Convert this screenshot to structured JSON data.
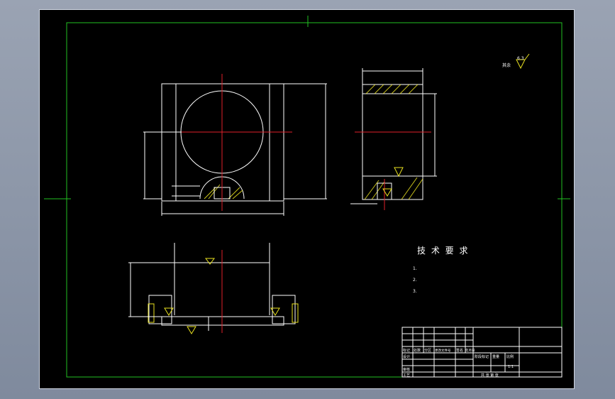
{
  "drawing": {
    "tech_requirements_title": "技 术 要 求",
    "tech_requirements": [
      "1.",
      "2.",
      "3."
    ],
    "surface_roughness_note": "其余",
    "roughness_value": "6.3"
  },
  "title_block": {
    "name_cell": "",
    "row_labels": [
      "标记",
      "处数",
      "分区",
      "更改文件号",
      "签名",
      "年月日"
    ],
    "roles": [
      "设计",
      "审核",
      "工艺"
    ],
    "right_labels": [
      "阶段标记",
      "重量",
      "比例"
    ],
    "scale": "1:1",
    "sheet": "共  张  第  张"
  },
  "colors": {
    "background": "#000000",
    "frame": "#22c022",
    "outline": "#ffffff",
    "centerline": "#e0202a",
    "dimension": "#e8e020"
  }
}
